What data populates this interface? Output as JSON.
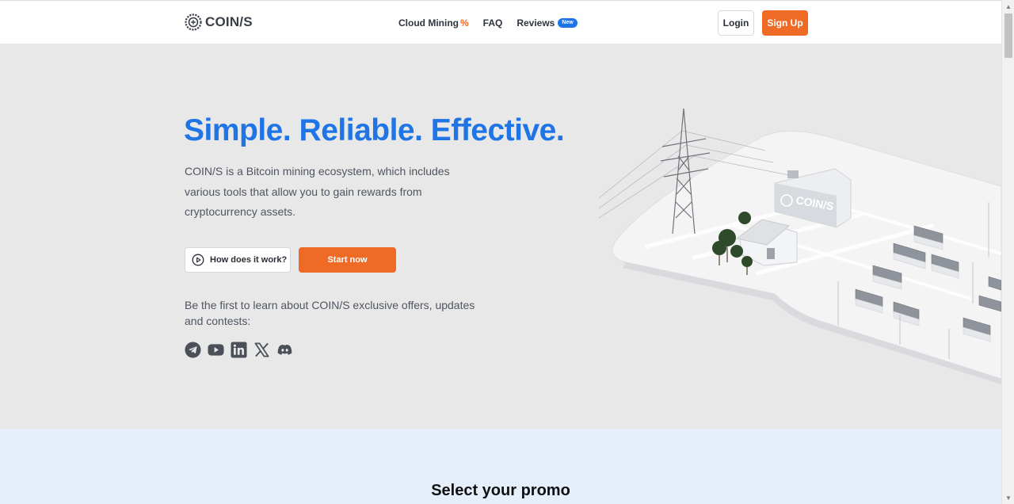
{
  "header": {
    "logo_text": "COIN/S",
    "nav": {
      "cloud_mining": "Cloud Mining",
      "cloud_mining_mark": "%",
      "faq": "FAQ",
      "reviews": "Reviews",
      "reviews_badge": "New"
    },
    "login_label": "Login",
    "signup_label": "Sign Up"
  },
  "hero": {
    "title": "Simple. Reliable. Effective.",
    "description": "COIN/S is a Bitcoin mining ecosystem, which includes various tools that allow you to gain rewards from cryptocurrency assets.",
    "how_button_label": "How does it work?",
    "start_button_label": "Start now",
    "subscribe_text": "Be the first to learn about COIN/S exclusive offers, updates and contests:",
    "social_icons": [
      "telegram-icon",
      "youtube-icon",
      "linkedin-icon",
      "x-icon",
      "discord-icon"
    ],
    "illustration_logo": "COIN/S"
  },
  "promo": {
    "title": "Select your promo"
  },
  "colors": {
    "accent_blue": "#1f74e6",
    "accent_orange": "#ef6a24",
    "hero_bg": "#e8e8e8",
    "promo_bg": "#e5effb"
  }
}
